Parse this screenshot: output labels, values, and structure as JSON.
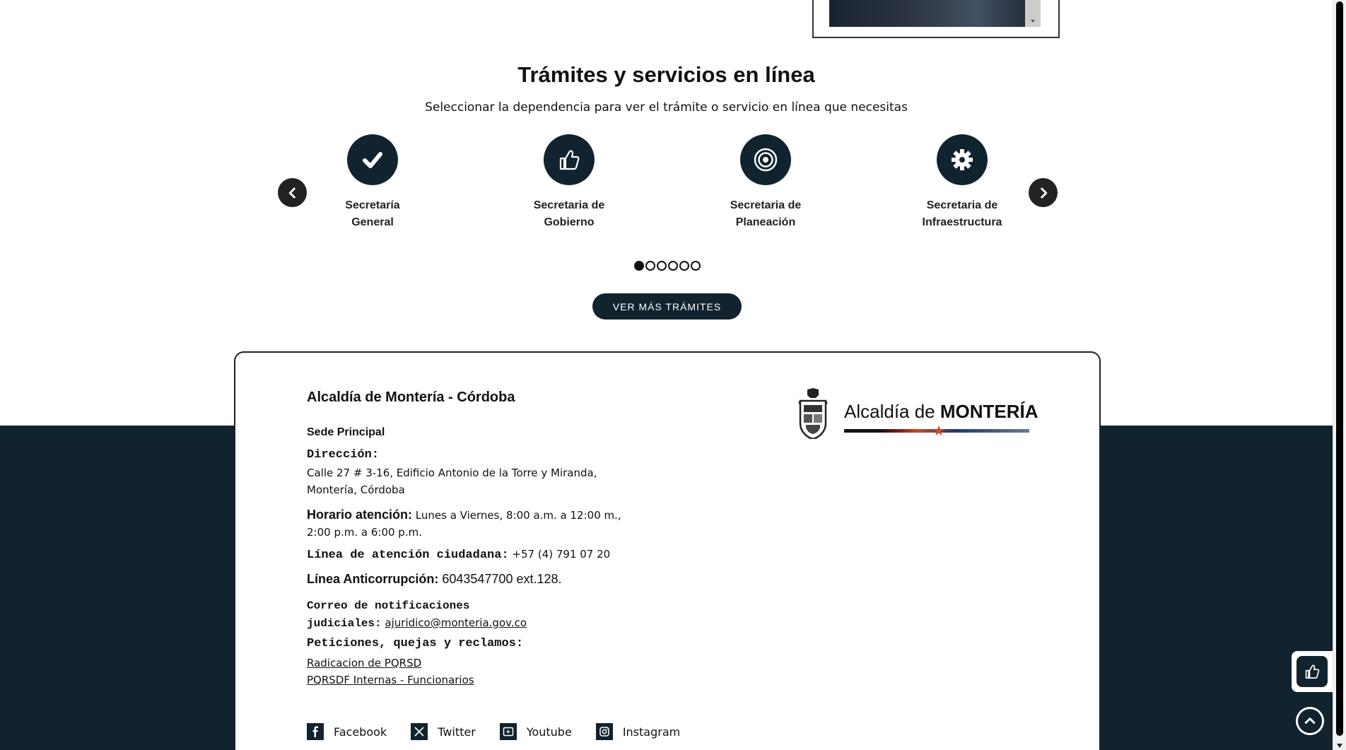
{
  "section": {
    "title": "Trámites y servicios en línea",
    "subtitle": "Seleccionar la dependencia para ver el trámite o servicio en línea que necesitas"
  },
  "services": [
    {
      "line1": "Secretaría",
      "line2": "General",
      "icon": "check-icon"
    },
    {
      "line1": "Secretaria de",
      "line2": "Gobierno",
      "icon": "thumbs-up-icon"
    },
    {
      "line1": "Secretaria de",
      "line2": "Planeación",
      "icon": "target-icon"
    },
    {
      "line1": "Secretaria de",
      "line2": "Infraestructura",
      "icon": "gear-icon"
    }
  ],
  "carousel": {
    "pages": 6,
    "active_page": 1
  },
  "ver_mas_label": "VER MÁS TRÁMITES",
  "footer": {
    "title": "Alcaldía de Montería - Córdoba",
    "sede": "Sede Principal",
    "direccion_label": "Dirección:",
    "direccion_line1": "Calle 27 # 3-16, Edificio Antonio de la Torre y Miranda,",
    "direccion_line2": "Montería, Córdoba",
    "horario_label": "Horario atención:",
    "horario_value": " Lunes a Viernes, 8:00 a.m. a 12:00 m.,",
    "horario_line2": "2:00 p.m. a 6:00 p.m.",
    "linea_label": "Línea de atención ciudadana:",
    "linea_value": " +57 (4) 791 07 20",
    "anti_label": "Línea Anticorrupción:",
    "anti_value": " 6043547700 ext.128.",
    "correo_label1": "Correo de notificaciones",
    "correo_label2": "judiciales:",
    "correo_value": "ajuridico@monteria.gov.co",
    "pqr_label": "Peticiones, quejas y reclamos:",
    "pqr_link1": "Radicacion de PQRSD",
    "pqr_link2": "PQRSDF Internas - Funcionarios",
    "logo_text_regular": "Alcaldía de ",
    "logo_text_bold": "MONTERÍA"
  },
  "social": [
    {
      "label": "Facebook",
      "icon": "facebook-icon"
    },
    {
      "label": "Twitter",
      "icon": "x-twitter-icon"
    },
    {
      "label": "Youtube",
      "icon": "youtube-icon"
    },
    {
      "label": "Instagram",
      "icon": "instagram-icon"
    }
  ],
  "colors": {
    "primary": "#10232f",
    "accent_star": "#d9432a"
  }
}
